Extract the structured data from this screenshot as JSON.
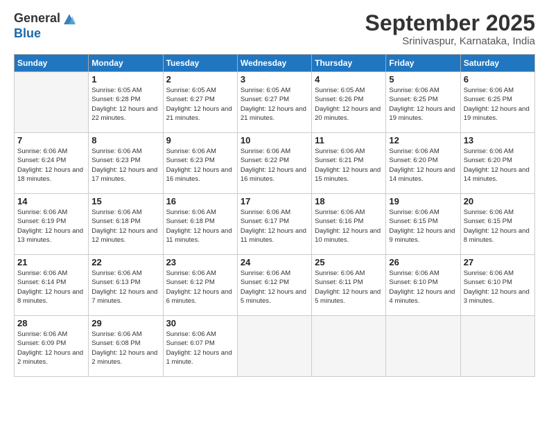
{
  "header": {
    "logo_general": "General",
    "logo_blue": "Blue",
    "month_title": "September 2025",
    "subtitle": "Srinivaspur, Karnataka, India"
  },
  "weekdays": [
    "Sunday",
    "Monday",
    "Tuesday",
    "Wednesday",
    "Thursday",
    "Friday",
    "Saturday"
  ],
  "weeks": [
    [
      {
        "day": "",
        "empty": true
      },
      {
        "day": "1",
        "sunrise": "6:05 AM",
        "sunset": "6:28 PM",
        "daylight": "12 hours and 22 minutes."
      },
      {
        "day": "2",
        "sunrise": "6:05 AM",
        "sunset": "6:27 PM",
        "daylight": "12 hours and 21 minutes."
      },
      {
        "day": "3",
        "sunrise": "6:05 AM",
        "sunset": "6:27 PM",
        "daylight": "12 hours and 21 minutes."
      },
      {
        "day": "4",
        "sunrise": "6:05 AM",
        "sunset": "6:26 PM",
        "daylight": "12 hours and 20 minutes."
      },
      {
        "day": "5",
        "sunrise": "6:06 AM",
        "sunset": "6:25 PM",
        "daylight": "12 hours and 19 minutes."
      },
      {
        "day": "6",
        "sunrise": "6:06 AM",
        "sunset": "6:25 PM",
        "daylight": "12 hours and 19 minutes."
      }
    ],
    [
      {
        "day": "7",
        "sunrise": "6:06 AM",
        "sunset": "6:24 PM",
        "daylight": "12 hours and 18 minutes."
      },
      {
        "day": "8",
        "sunrise": "6:06 AM",
        "sunset": "6:23 PM",
        "daylight": "12 hours and 17 minutes."
      },
      {
        "day": "9",
        "sunrise": "6:06 AM",
        "sunset": "6:23 PM",
        "daylight": "12 hours and 16 minutes."
      },
      {
        "day": "10",
        "sunrise": "6:06 AM",
        "sunset": "6:22 PM",
        "daylight": "12 hours and 16 minutes."
      },
      {
        "day": "11",
        "sunrise": "6:06 AM",
        "sunset": "6:21 PM",
        "daylight": "12 hours and 15 minutes."
      },
      {
        "day": "12",
        "sunrise": "6:06 AM",
        "sunset": "6:20 PM",
        "daylight": "12 hours and 14 minutes."
      },
      {
        "day": "13",
        "sunrise": "6:06 AM",
        "sunset": "6:20 PM",
        "daylight": "12 hours and 14 minutes."
      }
    ],
    [
      {
        "day": "14",
        "sunrise": "6:06 AM",
        "sunset": "6:19 PM",
        "daylight": "12 hours and 13 minutes."
      },
      {
        "day": "15",
        "sunrise": "6:06 AM",
        "sunset": "6:18 PM",
        "daylight": "12 hours and 12 minutes."
      },
      {
        "day": "16",
        "sunrise": "6:06 AM",
        "sunset": "6:18 PM",
        "daylight": "12 hours and 11 minutes."
      },
      {
        "day": "17",
        "sunrise": "6:06 AM",
        "sunset": "6:17 PM",
        "daylight": "12 hours and 11 minutes."
      },
      {
        "day": "18",
        "sunrise": "6:06 AM",
        "sunset": "6:16 PM",
        "daylight": "12 hours and 10 minutes."
      },
      {
        "day": "19",
        "sunrise": "6:06 AM",
        "sunset": "6:15 PM",
        "daylight": "12 hours and 9 minutes."
      },
      {
        "day": "20",
        "sunrise": "6:06 AM",
        "sunset": "6:15 PM",
        "daylight": "12 hours and 8 minutes."
      }
    ],
    [
      {
        "day": "21",
        "sunrise": "6:06 AM",
        "sunset": "6:14 PM",
        "daylight": "12 hours and 8 minutes."
      },
      {
        "day": "22",
        "sunrise": "6:06 AM",
        "sunset": "6:13 PM",
        "daylight": "12 hours and 7 minutes."
      },
      {
        "day": "23",
        "sunrise": "6:06 AM",
        "sunset": "6:12 PM",
        "daylight": "12 hours and 6 minutes."
      },
      {
        "day": "24",
        "sunrise": "6:06 AM",
        "sunset": "6:12 PM",
        "daylight": "12 hours and 5 minutes."
      },
      {
        "day": "25",
        "sunrise": "6:06 AM",
        "sunset": "6:11 PM",
        "daylight": "12 hours and 5 minutes."
      },
      {
        "day": "26",
        "sunrise": "6:06 AM",
        "sunset": "6:10 PM",
        "daylight": "12 hours and 4 minutes."
      },
      {
        "day": "27",
        "sunrise": "6:06 AM",
        "sunset": "6:10 PM",
        "daylight": "12 hours and 3 minutes."
      }
    ],
    [
      {
        "day": "28",
        "sunrise": "6:06 AM",
        "sunset": "6:09 PM",
        "daylight": "12 hours and 2 minutes."
      },
      {
        "day": "29",
        "sunrise": "6:06 AM",
        "sunset": "6:08 PM",
        "daylight": "12 hours and 2 minutes."
      },
      {
        "day": "30",
        "sunrise": "6:06 AM",
        "sunset": "6:07 PM",
        "daylight": "12 hours and 1 minute."
      },
      {
        "day": "",
        "empty": true
      },
      {
        "day": "",
        "empty": true
      },
      {
        "day": "",
        "empty": true
      },
      {
        "day": "",
        "empty": true
      }
    ]
  ]
}
